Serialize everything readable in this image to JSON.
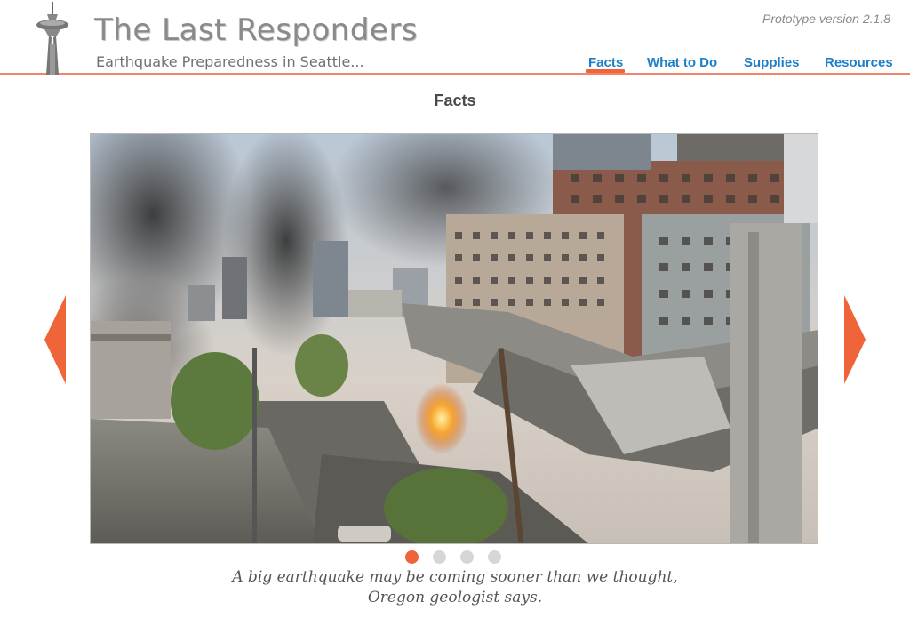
{
  "header": {
    "title": "The Last Responders",
    "subtitle": "Earthquake Preparedness in Seattle...",
    "version": "Prototype version 2.1.8",
    "logo_icon": "space-needle-icon"
  },
  "nav": {
    "items": [
      {
        "label": "Facts",
        "active": true
      },
      {
        "label": "What to Do",
        "active": false
      },
      {
        "label": "Supplies",
        "active": false
      },
      {
        "label": "Resources",
        "active": false
      }
    ]
  },
  "page": {
    "title": "Facts"
  },
  "carousel": {
    "image_icon": "collapsed-city-photo",
    "prev_icon": "triangle-left-icon",
    "next_icon": "triangle-right-icon",
    "slide_count": 4,
    "active_slide": 1,
    "caption_line1": "A big earthquake may be coming sooner than we thought,",
    "caption_line2": "Oregon geologist says."
  },
  "colors": {
    "accent": "#f0643a",
    "link": "#1e7ec8",
    "divider": "#f0856a",
    "dot_inactive": "#d6d6d6"
  }
}
